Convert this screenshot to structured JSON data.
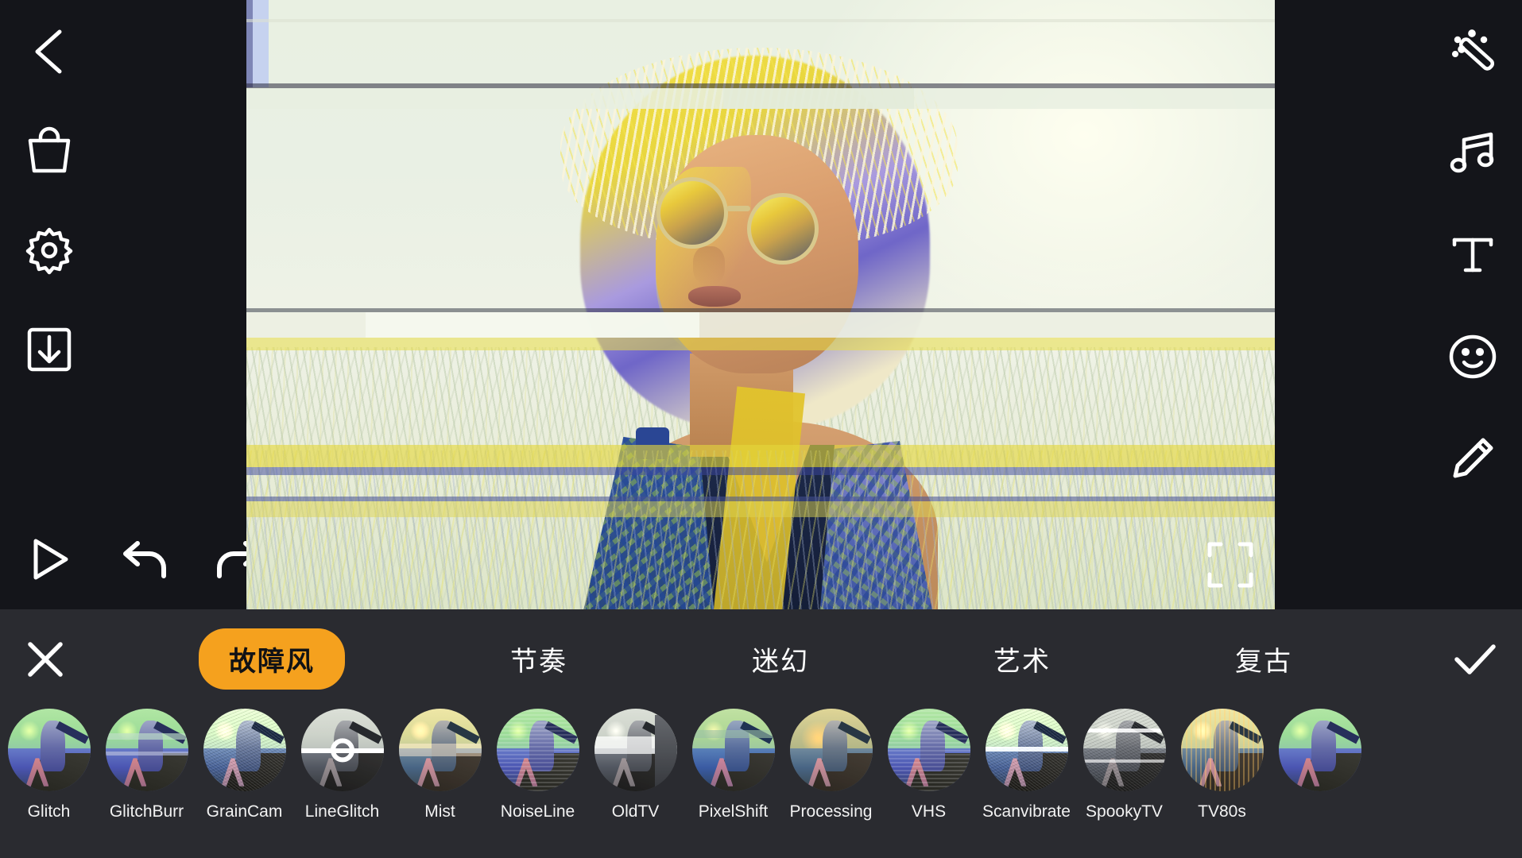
{
  "app": {
    "theme_bg": "#14151a",
    "panel_bg": "#2a2b30",
    "accent": "#F5A11E"
  },
  "left_rail": {
    "items": [
      {
        "icon": "back-chevron-icon",
        "label": "Back"
      },
      {
        "icon": "shopping-bag-icon",
        "label": "Store"
      },
      {
        "icon": "gear-icon",
        "label": "Settings"
      },
      {
        "icon": "save-download-icon",
        "label": "Save"
      }
    ]
  },
  "transport": {
    "items": [
      {
        "icon": "play-icon",
        "label": "Play"
      },
      {
        "icon": "undo-icon",
        "label": "Undo"
      },
      {
        "icon": "redo-icon",
        "label": "Redo"
      }
    ]
  },
  "right_rail": {
    "items": [
      {
        "icon": "magic-wand-icon",
        "label": "Effects"
      },
      {
        "icon": "music-note-icon",
        "label": "Music"
      },
      {
        "icon": "text-icon",
        "label": "Text"
      },
      {
        "icon": "smiley-sticker-icon",
        "label": "Sticker"
      },
      {
        "icon": "pencil-icon",
        "label": "Draw"
      }
    ]
  },
  "canvas": {
    "fullscreen_icon": "fullscreen-expand-icon",
    "description": "Glitch-effect photo of a woman with round sunglasses standing in a sunlit grass field"
  },
  "panel": {
    "close_icon": "close-x-icon",
    "confirm_icon": "checkmark-icon",
    "tabs": [
      {
        "label": "故障风",
        "active": true
      },
      {
        "label": "节奏",
        "active": false
      },
      {
        "label": "迷幻",
        "active": false
      },
      {
        "label": "艺术",
        "active": false
      },
      {
        "label": "复古",
        "active": false
      }
    ],
    "filters": [
      {
        "label": "Glitch",
        "style": "th-cool",
        "selected": false
      },
      {
        "label": "GlitchBurr",
        "style": "th-cool",
        "selected": false
      },
      {
        "label": "GrainCam",
        "style": "th-grain",
        "selected": false
      },
      {
        "label": "LineGlitch",
        "style": "th-mono",
        "selected": true
      },
      {
        "label": "Mist",
        "style": "th-warm",
        "selected": false
      },
      {
        "label": "NoiseLine",
        "style": "th-cool",
        "selected": false
      },
      {
        "label": "OldTV",
        "style": "th-mono",
        "selected": false
      },
      {
        "label": "PixelShift",
        "style": "th-pix",
        "selected": false
      },
      {
        "label": "Processing",
        "style": "th-warm",
        "selected": false
      },
      {
        "label": "VHS",
        "style": "th-cool",
        "selected": false
      },
      {
        "label": "Scanvibrate",
        "style": "th-grain",
        "selected": false
      },
      {
        "label": "SpookyTV",
        "style": "th-mono",
        "selected": false
      },
      {
        "label": "TV80s",
        "style": "th-warm",
        "selected": false
      },
      {
        "label": "",
        "style": "th-cool",
        "selected": false
      }
    ]
  }
}
